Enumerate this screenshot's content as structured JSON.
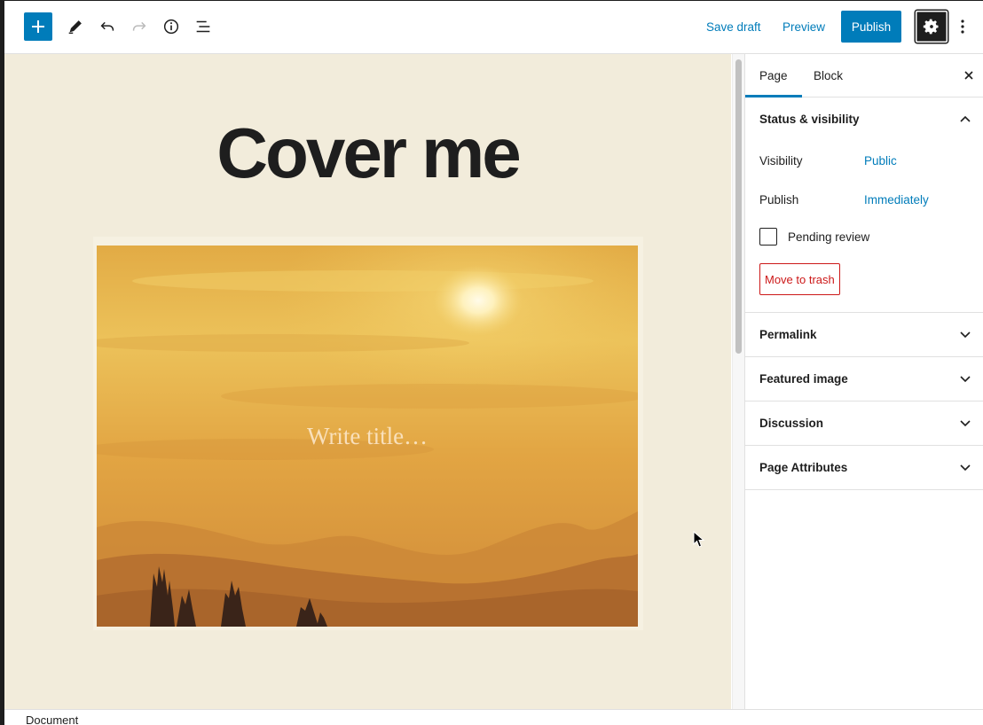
{
  "toolbar": {
    "inserter_icon": "plus-icon",
    "edit_icon": "pencil-icon",
    "undo_icon": "undo-icon",
    "redo_icon": "redo-icon",
    "info_icon": "info-icon",
    "outline_icon": "list-view-icon",
    "save_draft_label": "Save draft",
    "preview_label": "Preview",
    "publish_label": "Publish",
    "settings_icon": "gear-icon",
    "more_icon": "vertical-ellipsis-icon"
  },
  "canvas": {
    "title": "Cover me",
    "cover_placeholder": "Write title…",
    "background_color": "#f2ecdb"
  },
  "sidebar": {
    "tabs": [
      {
        "label": "Page",
        "active": true
      },
      {
        "label": "Block",
        "active": false
      }
    ],
    "close_icon": "close-icon",
    "status_panel": {
      "title": "Status & visibility",
      "visibility_label": "Visibility",
      "visibility_value": "Public",
      "publish_label": "Publish",
      "publish_value": "Immediately",
      "pending_label": "Pending review",
      "trash_label": "Move to trash"
    },
    "panels": [
      {
        "title": "Permalink"
      },
      {
        "title": "Featured image"
      },
      {
        "title": "Discussion"
      },
      {
        "title": "Page Attributes"
      }
    ]
  },
  "footer": {
    "breadcrumb": "Document"
  },
  "colors": {
    "accent": "#007cba",
    "danger": "#cc1818",
    "dark": "#1e1e1e"
  }
}
